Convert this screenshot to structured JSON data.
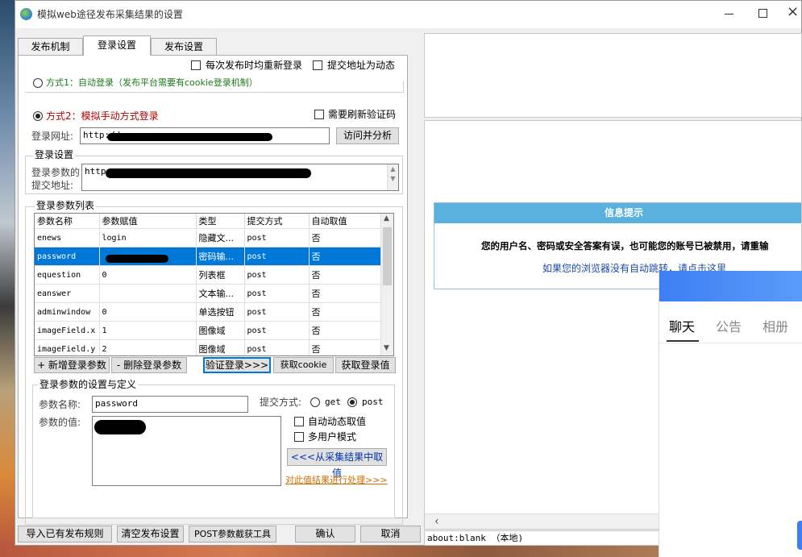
{
  "window": {
    "title": "模拟web途径发布采集结果的设置"
  },
  "tabs": [
    "发布机制",
    "登录设置",
    "发布设置"
  ],
  "top_options": {
    "relogin": "每次发布时均重新登录",
    "dynamic_url": "提交地址为动态"
  },
  "method1": {
    "label": "方式1：自动登录（发布平台需要有cookie登录机制）"
  },
  "method2": {
    "label": "方式2：模拟手动方式登录",
    "refresh_captcha": "需要刷新验证码"
  },
  "login_url": {
    "label": "登录网址:",
    "value": "http://",
    "button": "访问并分析"
  },
  "login_settings": {
    "title": "登录设置",
    "submit_label_1": "登录参数的",
    "submit_label_2": "提交地址:",
    "submit_value": "http"
  },
  "param_list": {
    "title": "登录参数列表",
    "columns": [
      "参数名称",
      "参数赋值",
      "类型",
      "提交方式",
      "自动取值"
    ],
    "rows": [
      {
        "name": "enews",
        "value": "login",
        "type": "隐藏文...",
        "method": "post",
        "auto": "否"
      },
      {
        "name": "password",
        "value": "",
        "type": "密码输...",
        "method": "post",
        "auto": "否"
      },
      {
        "name": "equestion",
        "value": "0",
        "type": "列表框",
        "method": "post",
        "auto": "否"
      },
      {
        "name": "eanswer",
        "value": "",
        "type": "文本输...",
        "method": "post",
        "auto": "否"
      },
      {
        "name": "adminwindow",
        "value": "0",
        "type": "单选按钮",
        "method": "post",
        "auto": "否"
      },
      {
        "name": "imageField.x",
        "value": "1",
        "type": "图像域",
        "method": "post",
        "auto": "否"
      },
      {
        "name": "imageField.y",
        "value": "2",
        "type": "图像域",
        "method": "post",
        "auto": "否"
      }
    ],
    "selected_index": 1
  },
  "action_buttons": {
    "add": "+ 新增登录参数",
    "delete": "- 删除登录参数",
    "verify": "验证登录>>>",
    "get_cookie": "获取cookie",
    "get_login_value": "获取登录值"
  },
  "param_def": {
    "title": "登录参数的设置与定义",
    "name_label": "参数名称:",
    "name_value": "password",
    "method_label": "提交方式:",
    "get": "get",
    "post": "post",
    "value_label": "参数的值:",
    "auto_dynamic": "自动动态取值",
    "multi_user": "多用户模式",
    "from_result": "<<<从采集结果中取值",
    "process_link": "对此值结果进行处理>>>"
  },
  "bottom_buttons": {
    "import": "导入已有发布规则",
    "clear": "清空发布设置",
    "post_capture": "POST参数截获工具",
    "ok": "确认",
    "cancel": "取消"
  },
  "browser": {
    "info_title": "信息提示",
    "message": "您的用户名、密码或安全答案有误，也可能您的账号已被禁用，请重输",
    "redirect_link": "如果您的浏览器没有自动跳转，请点击这里",
    "status": "about:blank （本地)"
  },
  "chat_popup": {
    "tabs": [
      "聊天",
      "公告",
      "相册"
    ]
  }
}
